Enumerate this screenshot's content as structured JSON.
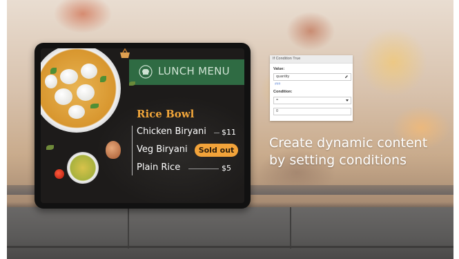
{
  "tablet": {
    "menu_title": "LUNCH MENU",
    "section_title": "Rice Bowl",
    "items": [
      {
        "name": "Chicken Biryani",
        "price": "$11"
      },
      {
        "name": "Veg Biryani",
        "badge": "Sold out"
      },
      {
        "name": "Plain Rice",
        "price": "$5"
      }
    ],
    "colors": {
      "banner": "#2f6b43",
      "accent": "#f0a53a",
      "badge": "#f2a33a"
    },
    "icons": [
      "chef-hat-icon",
      "basket-icon"
    ]
  },
  "condition_panel": {
    "header": "If Condition True",
    "value_label": "Value:",
    "value_field": "quantity",
    "link_text": "###",
    "condition_label": "Condition:",
    "condition_select": "=",
    "condition_value": "0"
  },
  "caption": {
    "line1": "Create dynamic content",
    "line2": "by setting conditions"
  }
}
